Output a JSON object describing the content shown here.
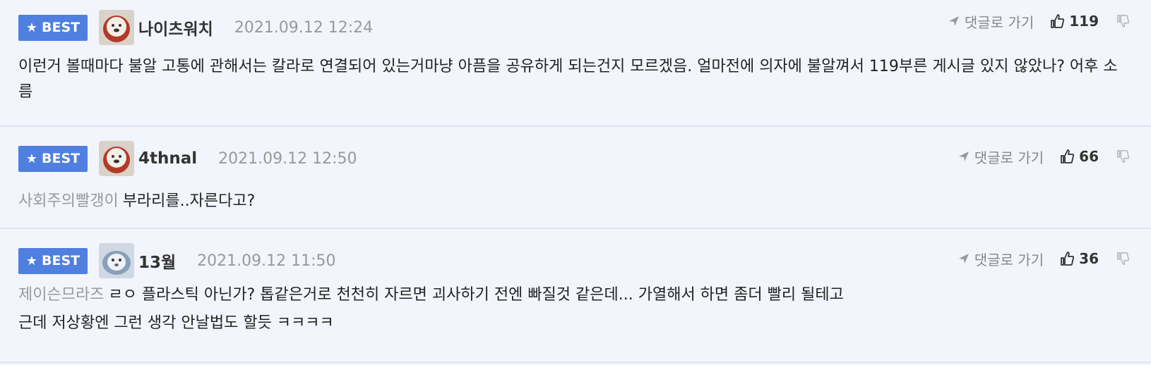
{
  "comments": [
    {
      "badge": "BEST",
      "nickname": "나이츠워치",
      "date": "2021.09.12 12:24",
      "reply_label": "댓글로 가기",
      "likes": "119",
      "mention": "",
      "text": "이런거 볼때마다 불알 고통에 관해서는 칼라로 연결되어 있는거마냥 아픔을 공유하게 되는건지 모르겠음. 얼마전에 의자에 불알껴서 119부른 게시글 있지 않았나? 어후 소름"
    },
    {
      "badge": "BEST",
      "nickname": "4thnal",
      "date": "2021.09.12 12:50",
      "reply_label": "댓글로 가기",
      "likes": "66",
      "mention": "사회주의빨갱이",
      "text": "부라리를..자른다고?"
    },
    {
      "badge": "BEST",
      "nickname": "13월",
      "date": "2021.09.12 11:50",
      "reply_label": "댓글로 가기",
      "likes": "36",
      "mention": "제이슨므라즈",
      "text": "ㄹㅇ 플라스틱 아닌가? 톱같은거로 천천히 자르면 괴사하기 전엔 빠질것 같은데... 가열해서 하면 좀더 빨리 될테고",
      "text_line2": "근데 저상황엔 그런 생각 안날법도 할듯 ㅋㅋㅋㅋ"
    }
  ],
  "icons": {
    "star": "star-icon",
    "reply": "reply-arrow-icon",
    "like": "thumbs-up-icon",
    "dislike": "thumbs-down-icon"
  },
  "colors": {
    "badge": "#4f7fdf",
    "background": "#f3f5fc",
    "mention": "#9a9a9a",
    "date": "#999999"
  }
}
